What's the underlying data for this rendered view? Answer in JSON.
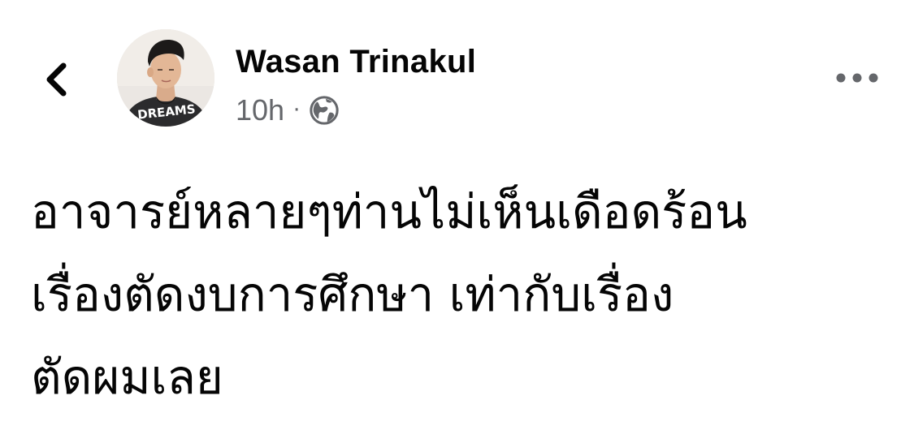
{
  "header": {
    "back_icon": "chevron-left-icon",
    "author_name": "Wasan Trinakul",
    "timestamp": "10h",
    "separator": "·",
    "privacy_icon": "globe-icon",
    "more_icon": "more-horizontal-icon",
    "avatar_shirt_text": "DREAMS"
  },
  "post": {
    "lines": [
      "อาจารย์หลายๆท่านไม่เห็นเดือดร้อน",
      "เรื่องตัดงบการศึกษา เท่ากับเรื่อง",
      "ตัดผมเลย"
    ]
  },
  "colors": {
    "text_primary": "#050505",
    "text_secondary": "#65676b",
    "background": "#ffffff"
  }
}
